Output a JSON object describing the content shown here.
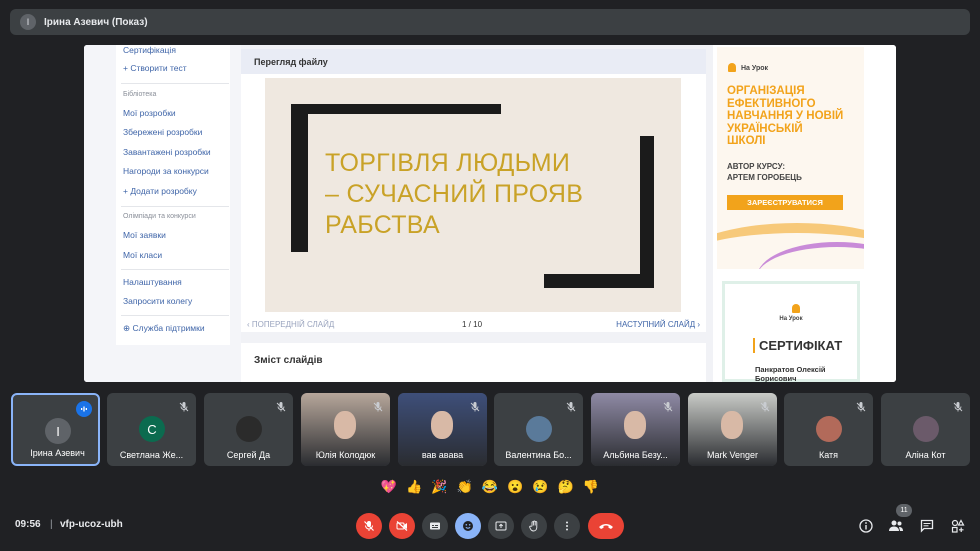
{
  "presenter": {
    "initial": "I",
    "title": "Ірина Азевич (Показ)"
  },
  "sidebar": {
    "items": [
      {
        "label": "Сертифікація"
      },
      {
        "label": "+ Створити тест"
      }
    ],
    "library_section": "Бібліотека",
    "library_items": [
      {
        "label": "Мої розробки"
      },
      {
        "label": "Збережені розробки"
      },
      {
        "label": "Завантажені розробки"
      },
      {
        "label": "Нагороди за конкурси"
      },
      {
        "label": "+ Додати розробку"
      }
    ],
    "olympiad_section": "Олімпіади та конкурси",
    "olympiad_items": [
      {
        "label": "Мої заявки"
      },
      {
        "label": "Мої класи"
      }
    ],
    "settings_items": [
      {
        "label": "Налаштування"
      },
      {
        "label": "Запросити колегу"
      }
    ],
    "support": "Служба підтримки"
  },
  "viewer": {
    "header": "Перегляд файлу",
    "slide_title_lines": [
      "ТОРГІВЛЯ ЛЮДЬМИ",
      "– СУЧАСНИЙ ПРОЯВ",
      "РАБСТВА"
    ],
    "prev": "ПОПЕРЕДНІЙ СЛАЙД",
    "count": "1 / 10",
    "next": "НАСТУПНИЙ СЛАЙД",
    "contents_title": "Зміст слайдів"
  },
  "ad": {
    "brand": "На Урок",
    "headline_lines": [
      "ОРГАНІЗАЦІЯ",
      "ЕФЕКТИВНОГО",
      "НАВЧАННЯ У НОВІЙ",
      "УКРАЇНСЬКІЙ",
      "ШКОЛІ"
    ],
    "author_lines": [
      "АВТОР КУРСУ:",
      "АРТЕМ ГОРОБЕЦЬ"
    ],
    "button": "ЗАРЕЄСТРУВАТИСЯ",
    "accent": "#f2a31b"
  },
  "certificate": {
    "brand": "На Урок",
    "title": "СЕРТИФІКАТ",
    "name_lines": [
      "Панкратов Олексій",
      "Борисович"
    ]
  },
  "participants": [
    {
      "name": "Ірина Азевич",
      "initial": "I",
      "avatar_color": "#5f6368",
      "active": true
    },
    {
      "name": "Светлана Же...",
      "initial": "C",
      "avatar_color": "#0b6b4f"
    },
    {
      "name": "Сергей Да",
      "initial": "",
      "avatar_color": "#2b2b2b"
    },
    {
      "name": "Юлія Колодюк",
      "photo_color": "#b7a79b"
    },
    {
      "name": "вав авава",
      "photo_color": "#3e4f7a"
    },
    {
      "name": "Валентина Бо...",
      "initial": "",
      "avatar_color": "#5a7a9a"
    },
    {
      "name": "Альбина Безу...",
      "photo_color": "#8f8aa5"
    },
    {
      "name": "Mark Venger",
      "photo_color": "#c9cbc7"
    },
    {
      "name": "Катя",
      "initial": "",
      "avatar_color": "#b26a5a"
    },
    {
      "name": "Аліна Кот",
      "initial": "",
      "avatar_color": "#6b5a6a"
    }
  ],
  "reactions": [
    "💖",
    "👍",
    "🎉",
    "👏",
    "😂",
    "😮",
    "😢",
    "🤔",
    "👎"
  ],
  "footer": {
    "time": "09:56",
    "separator": "|",
    "meeting_code": "vfp-ucoz-ubh",
    "participant_count": "11"
  }
}
